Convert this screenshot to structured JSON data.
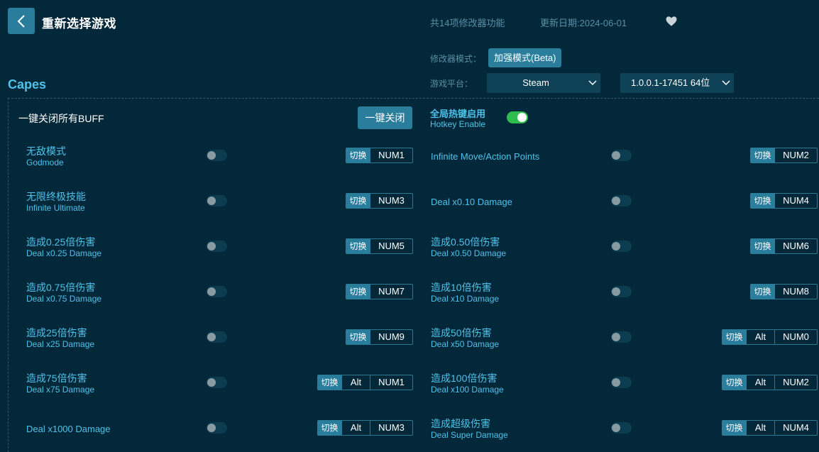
{
  "header": {
    "title": "重新选择游戏",
    "feature_count": "共14项修改器功能",
    "update_date": "更新日期:2024-06-01"
  },
  "settings": {
    "mode_label": "修改器模式：",
    "mode_value": "加强模式(Beta)",
    "platform_label": "游戏平台：",
    "platform_value": "Steam",
    "version_value": "1.0.0.1-17451 64位"
  },
  "game": {
    "name": "Capes"
  },
  "controls": {
    "buff_label": "一键关闭所有BUFF",
    "close_all_button": "一键关闭",
    "hotkey_cn": "全局热键启用",
    "hotkey_en": "Hotkey Enable",
    "hotkey_enabled": true
  },
  "switch_label": "切换",
  "cheats": [
    {
      "cn": "无敌模式",
      "en": "Godmode",
      "keys": [
        "NUM1"
      ],
      "on": false
    },
    {
      "cn": "",
      "en": "Infinite Move/Action Points",
      "keys": [
        "NUM2"
      ],
      "on": false
    },
    {
      "cn": "无限终极技能",
      "en": "Infinite Ultimate",
      "keys": [
        "NUM3"
      ],
      "on": false
    },
    {
      "cn": "",
      "en": "Deal x0.10 Damage",
      "keys": [
        "NUM4"
      ],
      "on": false
    },
    {
      "cn": "造成0.25倍伤害",
      "en": "Deal x0.25 Damage",
      "keys": [
        "NUM5"
      ],
      "on": false
    },
    {
      "cn": "造成0.50倍伤害",
      "en": "Deal x0.50 Damage",
      "keys": [
        "NUM6"
      ],
      "on": false
    },
    {
      "cn": "造成0.75倍伤害",
      "en": "Deal x0.75 Damage",
      "keys": [
        "NUM7"
      ],
      "on": false
    },
    {
      "cn": "造成10倍伤害",
      "en": "Deal x10 Damage",
      "keys": [
        "NUM8"
      ],
      "on": false
    },
    {
      "cn": "造成25倍伤害",
      "en": "Deal x25 Damage",
      "keys": [
        "NUM9"
      ],
      "on": false
    },
    {
      "cn": "造成50倍伤害",
      "en": "Deal x50 Damage",
      "keys": [
        "Alt",
        "NUM0"
      ],
      "on": false
    },
    {
      "cn": "造成75倍伤害",
      "en": "Deal x75 Damage",
      "keys": [
        "Alt",
        "NUM1"
      ],
      "on": false
    },
    {
      "cn": "造成100倍伤害",
      "en": "Deal x100 Damage",
      "keys": [
        "Alt",
        "NUM2"
      ],
      "on": false
    },
    {
      "cn": "",
      "en": "Deal x1000 Damage",
      "keys": [
        "Alt",
        "NUM3"
      ],
      "on": false
    },
    {
      "cn": "造成超级伤害",
      "en": "Deal Super Damage",
      "keys": [
        "Alt",
        "NUM4"
      ],
      "on": false
    }
  ],
  "colors": {
    "background": "#03283a",
    "accent": "#2a7e9c",
    "label": "#4ec3ea",
    "muted": "#5a8fa6",
    "switch_on": "#2fbd4f"
  }
}
